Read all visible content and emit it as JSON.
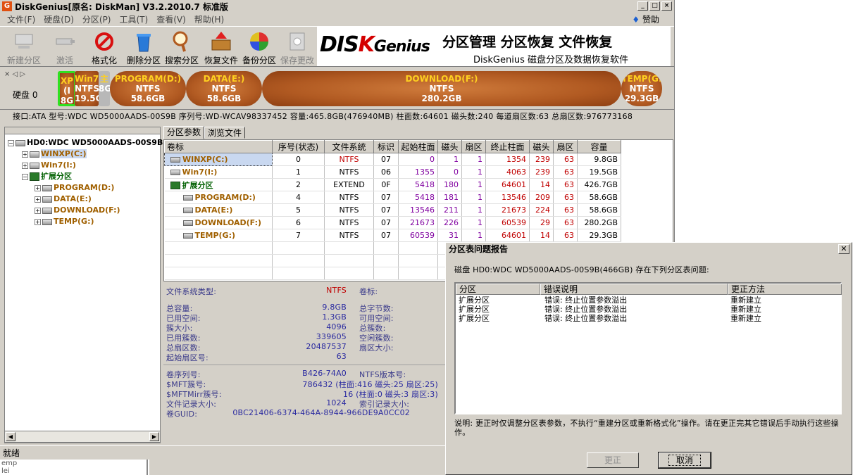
{
  "titlebar": {
    "title": "DiskGenius[原名: DiskMan] V3.2.2010.7 标准版",
    "icon": "G"
  },
  "menu": [
    "文件(F)",
    "硬盘(D)",
    "分区(P)",
    "工具(T)",
    "查看(V)",
    "帮助(H)"
  ],
  "sponsor": "赞助",
  "toolbar": [
    {
      "label": "新建分区",
      "icon": "new-partition-icon",
      "disabled": true
    },
    {
      "label": "激活",
      "icon": "activate-icon",
      "disabled": true
    },
    {
      "label": "格式化",
      "icon": "format-icon",
      "disabled": false
    },
    {
      "label": "删除分区",
      "icon": "delete-partition-icon",
      "disabled": false
    },
    {
      "label": "搜索分区",
      "icon": "search-partition-icon",
      "disabled": false
    },
    {
      "label": "恢复文件",
      "icon": "recover-files-icon",
      "disabled": false
    },
    {
      "label": "备份分区",
      "icon": "backup-partition-icon",
      "disabled": false
    },
    {
      "label": "保存更改",
      "icon": "save-changes-icon",
      "disabled": true
    }
  ],
  "banner": {
    "logo_pre": "DIS",
    "logo_k": "K",
    "logo_post": "Genius",
    "title": "分区管理 分区恢复 文件恢复",
    "subtitle": "DiskGenius 磁盘分区及数据恢复软件"
  },
  "diskbar": {
    "label": "硬盘 0"
  },
  "partitions_bar": [
    {
      "name": "XP",
      "fs": "(I",
      "size": "8G",
      "selected": true
    },
    {
      "name": "Win7(I",
      "fs": "NTFS",
      "size": "19.5G",
      "selected": false
    },
    {
      "name": "主",
      "fs": "8G",
      "size": "",
      "selected": false
    },
    {
      "name": "PROGRAM(D:)",
      "fs": "NTFS",
      "size": "58.6GB",
      "selected": false
    },
    {
      "name": "DATA(E:)",
      "fs": "NTFS",
      "size": "58.6GB",
      "selected": false
    },
    {
      "name": "DOWNLOAD(F:)",
      "fs": "NTFS",
      "size": "280.2GB",
      "selected": false
    },
    {
      "name": "TEMP(G:",
      "fs": "NTFS",
      "size": "29.3GB",
      "selected": false
    }
  ],
  "disk_info": "接口:ATA  型号:WDC WD5000AADS-00S9B  序列号:WD-WCAV98337452  容量:465.8GB(476940MB)  柱面数:64601  磁头数:240  每道扇区数:63  总扇区数:976773168",
  "tree": {
    "root": "HD0:WDC WD5000AADS-00S9B(",
    "items": [
      {
        "label": "WINXP(C:)",
        "level": 1,
        "color": "y",
        "expander": "+"
      },
      {
        "label": "Win7(I:)",
        "level": 1,
        "color": "y",
        "expander": "+"
      },
      {
        "label": "扩展分区",
        "level": 1,
        "color": "g",
        "expander": "−"
      },
      {
        "label": "PROGRAM(D:)",
        "level": 2,
        "color": "y",
        "expander": "+"
      },
      {
        "label": "DATA(E:)",
        "level": 2,
        "color": "y",
        "expander": "+"
      },
      {
        "label": "DOWNLOAD(F:)",
        "level": 2,
        "color": "y",
        "expander": "+"
      },
      {
        "label": "TEMP(G:)",
        "level": 2,
        "color": "y",
        "expander": "+"
      }
    ]
  },
  "tabs": [
    "分区参数",
    "浏览文件"
  ],
  "grid": {
    "headers": [
      "卷标",
      "序号(状态)",
      "文件系统",
      "标识",
      "起始柱面",
      "磁头",
      "扇区",
      "终止柱面",
      "磁头",
      "扇区",
      "容量"
    ],
    "rows": [
      {
        "vol": "WINXP(C:)",
        "idx": "0",
        "fs": "NTFS",
        "id": "07",
        "sc": "0",
        "sh": "1",
        "ss": "1",
        "ec": "1354",
        "eh": "239",
        "es": "63",
        "cap": "9.8GB",
        "indent": 0,
        "type": "hd",
        "sel": true,
        "fsred": true
      },
      {
        "vol": "Win7(I:)",
        "idx": "1",
        "fs": "NTFS",
        "id": "06",
        "sc": "1355",
        "sh": "0",
        "ss": "1",
        "ec": "4063",
        "eh": "239",
        "es": "63",
        "cap": "19.5GB",
        "indent": 0,
        "type": "hd",
        "sel": false,
        "fsred": false
      },
      {
        "vol": "扩展分区",
        "idx": "2",
        "fs": "EXTEND",
        "id": "0F",
        "sc": "5418",
        "sh": "180",
        "ss": "1",
        "ec": "64601",
        "eh": "14",
        "es": "63",
        "cap": "426.7GB",
        "indent": 0,
        "type": "ext",
        "sel": false,
        "fsred": false
      },
      {
        "vol": "PROGRAM(D:)",
        "idx": "4",
        "fs": "NTFS",
        "id": "07",
        "sc": "5418",
        "sh": "181",
        "ss": "1",
        "ec": "13546",
        "eh": "209",
        "es": "63",
        "cap": "58.6GB",
        "indent": 1,
        "type": "hd",
        "sel": false,
        "fsred": false
      },
      {
        "vol": "DATA(E:)",
        "idx": "5",
        "fs": "NTFS",
        "id": "07",
        "sc": "13546",
        "sh": "211",
        "ss": "1",
        "ec": "21673",
        "eh": "224",
        "es": "63",
        "cap": "58.6GB",
        "indent": 1,
        "type": "hd",
        "sel": false,
        "fsred": false
      },
      {
        "vol": "DOWNLOAD(F:)",
        "idx": "6",
        "fs": "NTFS",
        "id": "07",
        "sc": "21673",
        "sh": "226",
        "ss": "1",
        "ec": "60539",
        "eh": "29",
        "es": "63",
        "cap": "280.2GB",
        "indent": 1,
        "type": "hd",
        "sel": false,
        "fsred": false
      },
      {
        "vol": "TEMP(G:)",
        "idx": "7",
        "fs": "NTFS",
        "id": "07",
        "sc": "60539",
        "sh": "31",
        "ss": "1",
        "ec": "64601",
        "eh": "14",
        "es": "63",
        "cap": "29.3GB",
        "indent": 1,
        "type": "hd",
        "sel": false,
        "fsred": false
      }
    ]
  },
  "details": {
    "fs_type_label": "文件系统类型:",
    "fs_type_value": "NTFS",
    "volume_label": "卷标:",
    "left": [
      [
        "总容量:",
        "9.8GB"
      ],
      [
        "已用空间:",
        "1.3GB"
      ],
      [
        "簇大小:",
        "4096"
      ],
      [
        "已用簇数:",
        "339605"
      ],
      [
        "总扇区数:",
        "20487537"
      ],
      [
        "起始扇区号:",
        "63"
      ]
    ],
    "right": [
      "总字节数:",
      "可用空间:",
      "总簇数:",
      "空闲簇数:",
      "扇区大小:"
    ],
    "bottom": [
      [
        "卷序列号:",
        "B426-74A0",
        "NTFS版本号:"
      ],
      [
        "$MFT簇号:",
        "786432 (柱面:416 磁头:25 扇区:25)",
        ""
      ],
      [
        "$MFTMirr簇号:",
        "16 (柱面:0 磁头:3 扇区:3)",
        ""
      ],
      [
        "文件记录大小:",
        "1024",
        "索引记录大小:"
      ],
      [
        "卷GUID:",
        "0BC21406-6374-464A-8944-966DE9A0CC02",
        ""
      ]
    ]
  },
  "status": "就绪",
  "below": [
    "emp",
    "lei"
  ],
  "dialog": {
    "title": "分区表问题报告",
    "message": "磁盘 HD0:WDC WD5000AADS-00S9B(466GB) 存在下列分区表问题:",
    "columns": [
      "分区",
      "错误说明",
      "更正方法"
    ],
    "rows": [
      [
        "扩展分区",
        "错误: 终止位置参数溢出",
        "重新建立"
      ],
      [
        "扩展分区",
        "错误: 终止位置参数溢出",
        "重新建立"
      ],
      [
        "扩展分区",
        "错误: 终止位置参数溢出",
        "重新建立"
      ]
    ],
    "note": "说明: 更正时仅调整分区表参数，不执行“重建分区或重新格式化”操作。请在更正完其它错误后手动执行这些操作。",
    "fix_button": "更正",
    "cancel_button": "取消"
  }
}
